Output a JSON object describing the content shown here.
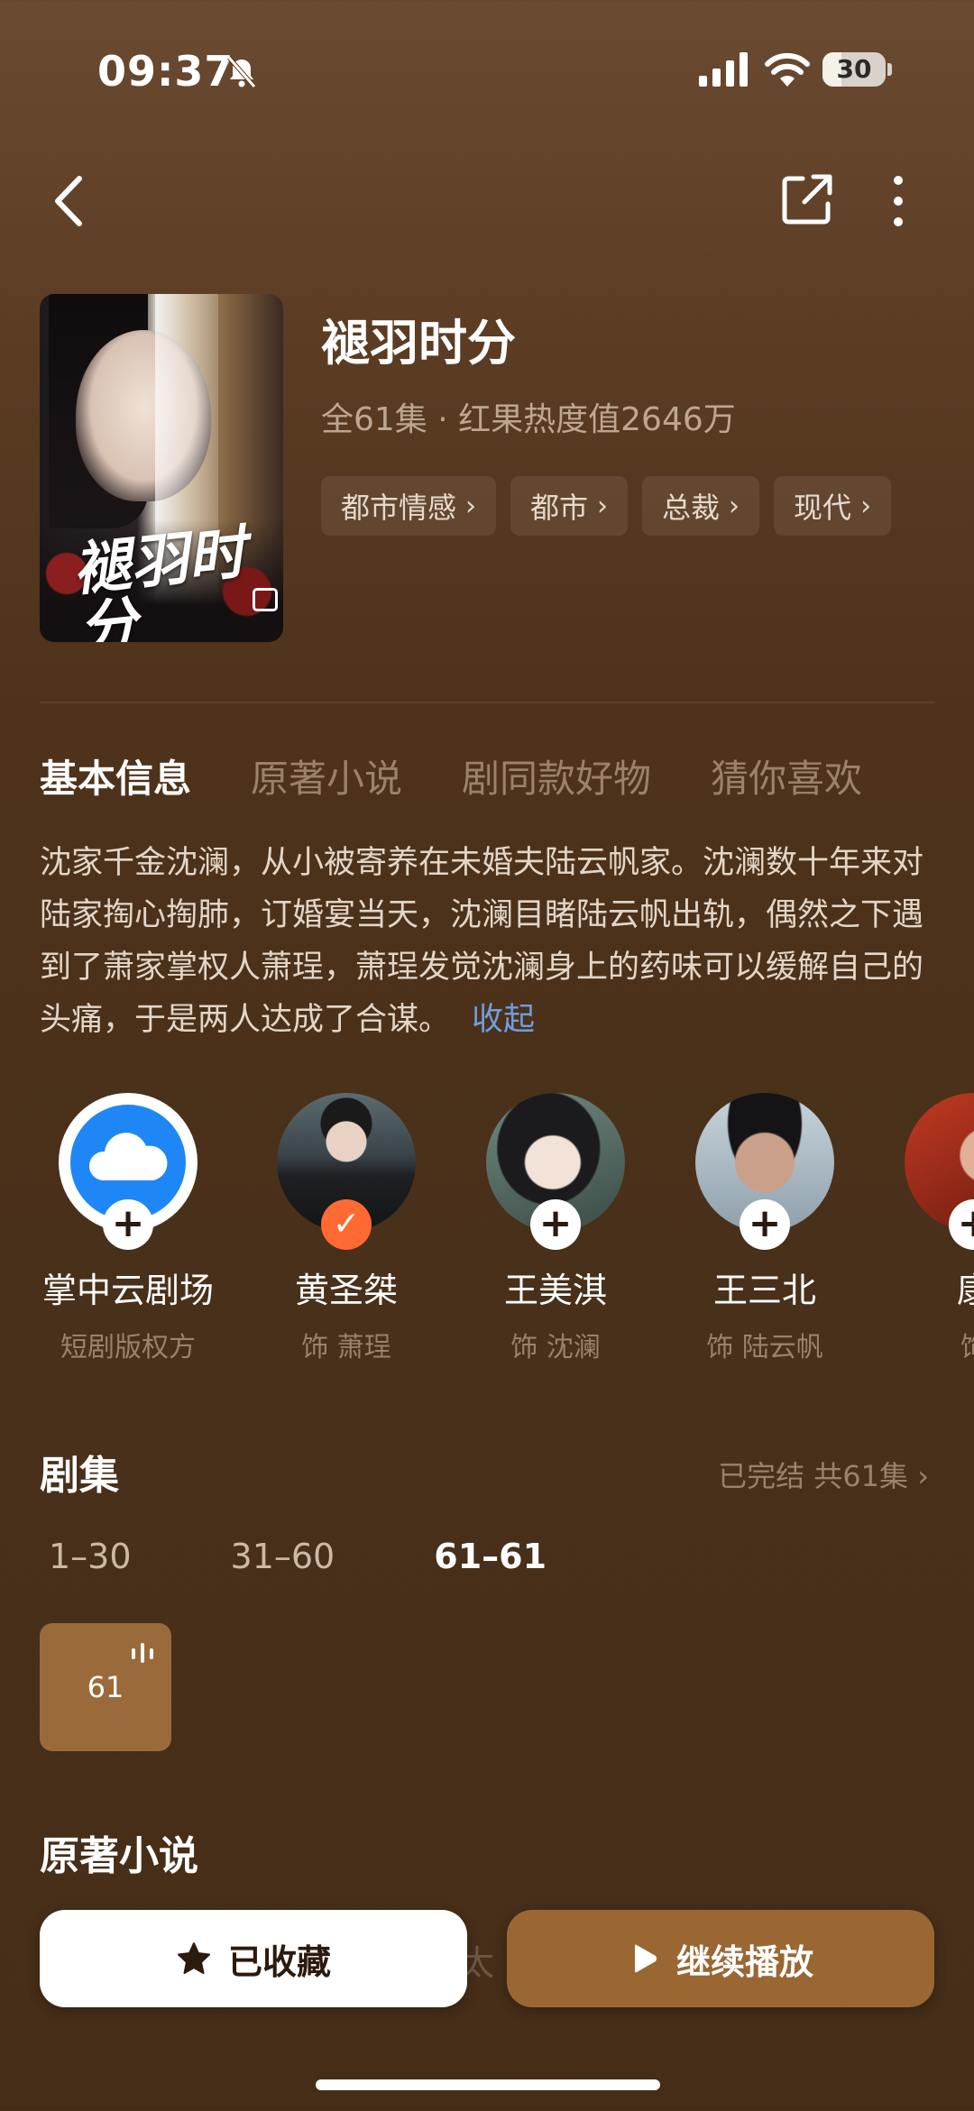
{
  "status_bar": {
    "time": "09:37",
    "battery": "30",
    "battery_level": 0.3
  },
  "drama": {
    "title": "褪羽时分",
    "cover_title": "褪羽时分",
    "meta": "全61集 · 红果热度值2646万",
    "tags": [
      "都市情感",
      "都市",
      "总裁",
      "现代"
    ]
  },
  "section_tabs": [
    "基本信息",
    "原著小说",
    "剧同款好物",
    "猜你喜欢"
  ],
  "synopsis": {
    "text": "沈家千金沈澜，从小被寄养在未婚夫陆云帆家。沈澜数十年来对陆家掏心掏肺，订婚宴当天，沈澜目睹陆云帆出轨，偶然之下遇到了萧家掌权人萧珵，萧珵发觉沈澜身上的药味可以缓解自己的头痛，于是两人达成了合谋。",
    "collapse_label": "收起"
  },
  "cast": [
    {
      "name": "掌中云剧场",
      "role": "短剧版权方",
      "badge": "+"
    },
    {
      "name": "黄圣桀",
      "role": "饰 萧珵",
      "badge": "✓"
    },
    {
      "name": "王美淇",
      "role": "饰 沈澜",
      "badge": "+"
    },
    {
      "name": "王三北",
      "role": "饰 陆云帆",
      "badge": "+"
    },
    {
      "name": "康",
      "role": "饰 ",
      "badge": "+"
    }
  ],
  "episodes": {
    "title": "剧集",
    "status": "已完结 共61集",
    "ranges": [
      "1–30",
      "31–60",
      "61–61"
    ],
    "current_episode": "61"
  },
  "novel": {
    "title": "原著小说",
    "faded_text": "太"
  },
  "buttons": {
    "favorite": "已收藏",
    "continue": "继续播放"
  },
  "colors": {
    "accent_button": "#9a6733",
    "followed_badge": "#ff6a33",
    "link": "#6f9fe0"
  }
}
